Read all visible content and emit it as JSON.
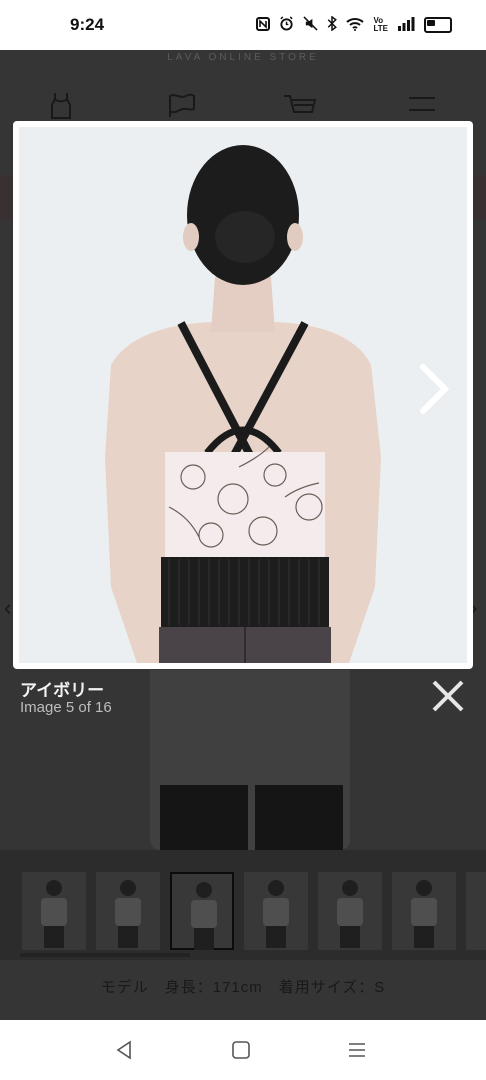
{
  "status_bar": {
    "time": "9:24",
    "icons": [
      "nfc-icon",
      "alarm-icon",
      "mute-icon",
      "bluetooth-icon",
      "wifi-icon",
      "volte-icon",
      "signal-icon",
      "battery-icon"
    ],
    "volte": "Vo\nLTE"
  },
  "page": {
    "store_name": "LAVA ONLINE STORE",
    "nav_icons": [
      "tank-top-icon",
      "flag-icon",
      "cart-icon",
      "menu-icon"
    ],
    "model_info": "モデル　身長：171cm　着用サイズ：S"
  },
  "modal": {
    "title": "アイボリー",
    "counter": "Image 5 of 16",
    "next_icon": "chevron-right-icon",
    "close_icon": "close-icon"
  },
  "thumbnails": {
    "count": 7,
    "active_index": 2
  },
  "colors": {
    "overlay": "#000000",
    "frame": "#ffffff",
    "top_print": "#f4ecec",
    "strap": "#1a1a1a",
    "skin": "#e9d6cc",
    "hair": "#1c1c1c"
  }
}
